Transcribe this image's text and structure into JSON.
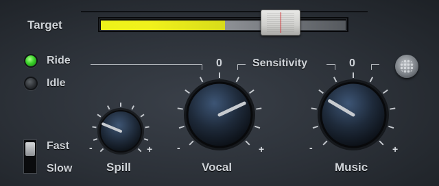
{
  "labels": {
    "target": "Target",
    "ride": "Ride",
    "idle": "Idle",
    "fast": "Fast",
    "slow": "Slow",
    "spill": "Spill",
    "vocal": "Vocal",
    "music": "Music",
    "sensitivity": "Sensitivity",
    "vocal_zero": "0",
    "music_zero": "0",
    "minus": "-",
    "plus": "+"
  },
  "meter": {
    "level_fraction": 0.5,
    "target_fraction": 0.73
  },
  "leds": {
    "ride": "on",
    "idle": "off"
  },
  "switch": {
    "position": "Fast"
  },
  "knobs": {
    "spill": {
      "value_fraction": 0.25
    },
    "vocal": {
      "value_fraction": 0.74
    },
    "music": {
      "value_fraction": 0.28
    }
  },
  "icons": {
    "settings": "grid-button-icon"
  },
  "colors": {
    "meter_fill": "#eef21a",
    "led_on": "#3ad12a",
    "target_line": "#d3262a"
  }
}
